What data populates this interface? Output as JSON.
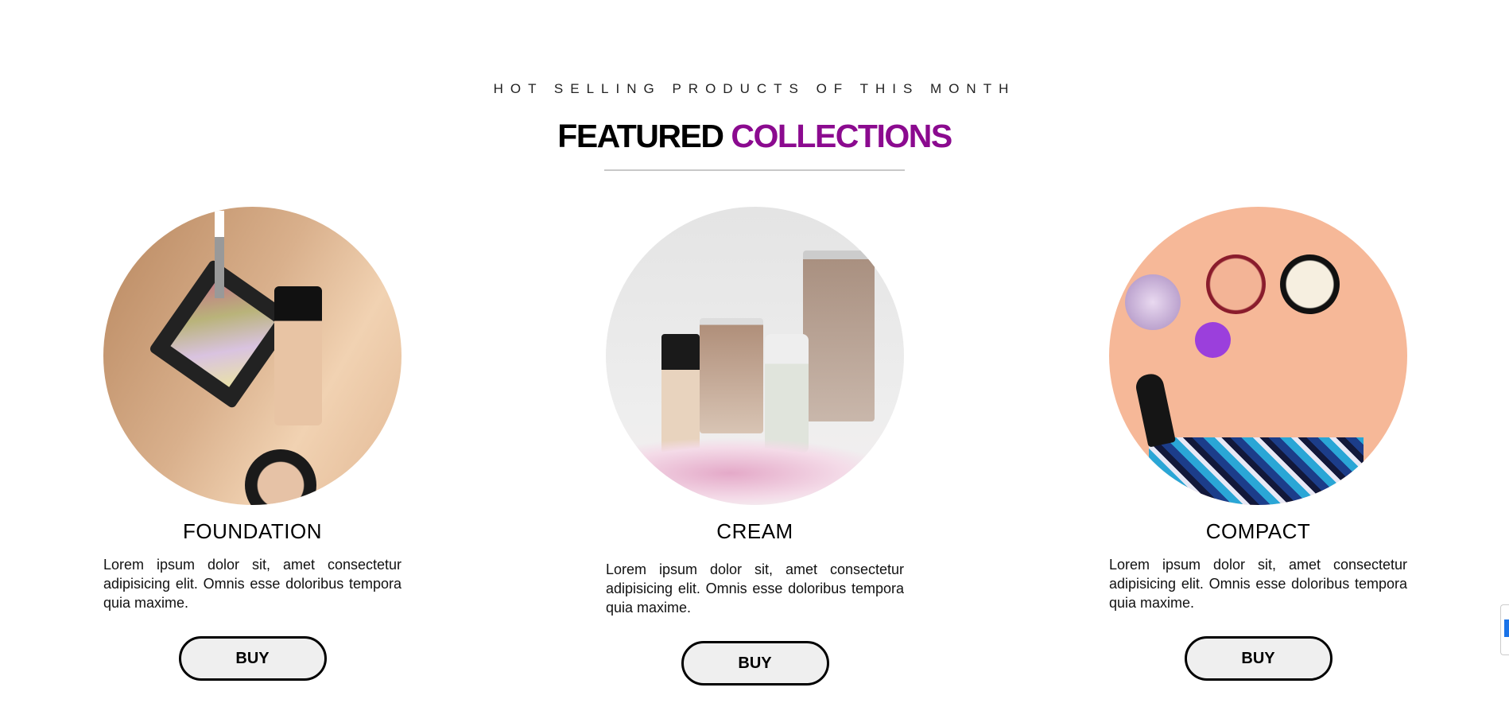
{
  "header": {
    "subtitle": "HOT SELLING PRODUCTS OF THIS MONTH",
    "title_part1": "FEATURED",
    "title_part2": "COLLECTIONS",
    "accent_color": "#8b0a8f"
  },
  "products": [
    {
      "name": "FOUNDATION",
      "description": "Lorem ipsum dolor sit, amet consectetur adipisicing elit. Omnis esse doloribus tempora quia maxime.",
      "button": "BUY"
    },
    {
      "name": "CREAM",
      "description": "Lorem ipsum dolor sit, amet consectetur adipisicing elit. Omnis esse doloribus tempora quia maxime.",
      "button": "BUY"
    },
    {
      "name": "COMPACT",
      "description": "Lorem ipsum dolor sit, amet consectetur adipisicing elit. Omnis esse doloribus tempora quia maxime.",
      "button": "BUY"
    }
  ],
  "recaptcha": {
    "icon": "recaptcha-badge-icon"
  }
}
